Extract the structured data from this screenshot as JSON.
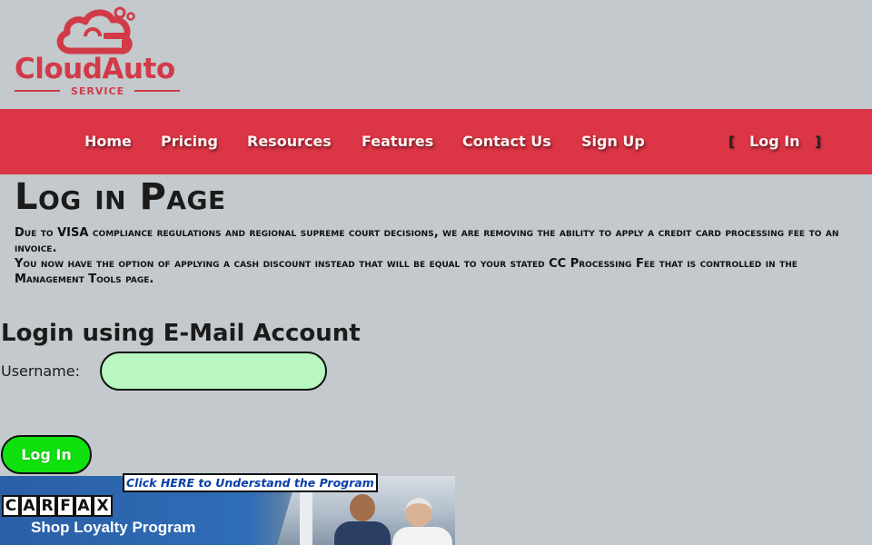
{
  "brand": {
    "name": "CloudAuto",
    "sub": "SERVICE",
    "color": "#d23a48"
  },
  "nav": {
    "items": [
      "Home",
      "Pricing",
      "Resources",
      "Features",
      "Contact Us",
      "Sign Up"
    ],
    "login_label": "Log In",
    "bracket_open": "[",
    "bracket_close": "]",
    "bg_color": "#dc3545"
  },
  "page": {
    "title": "Log in Page",
    "notice_line1": "Due to VISA compliance regulations and regional supreme court decisions, we are removing the ability to apply a credit card processing fee to an invoice.",
    "notice_line2": "You now have the option of applying a cash discount instead that will be equal to your stated CC Processing Fee that is controlled in the Management Tools page."
  },
  "login_form": {
    "heading": "Login using E-Mail Account",
    "username_label": "Username:",
    "username_value": "",
    "submit_label": "Log In",
    "input_color": "#b8f7bf",
    "button_color": "#0ee10e"
  },
  "banner": {
    "carfax_letters": [
      "C",
      "A",
      "R",
      "F",
      "A"
    ],
    "carfax_x": "X",
    "title": "Shop Loyalty Program",
    "link_text": "Click HERE to Understand the Program"
  }
}
